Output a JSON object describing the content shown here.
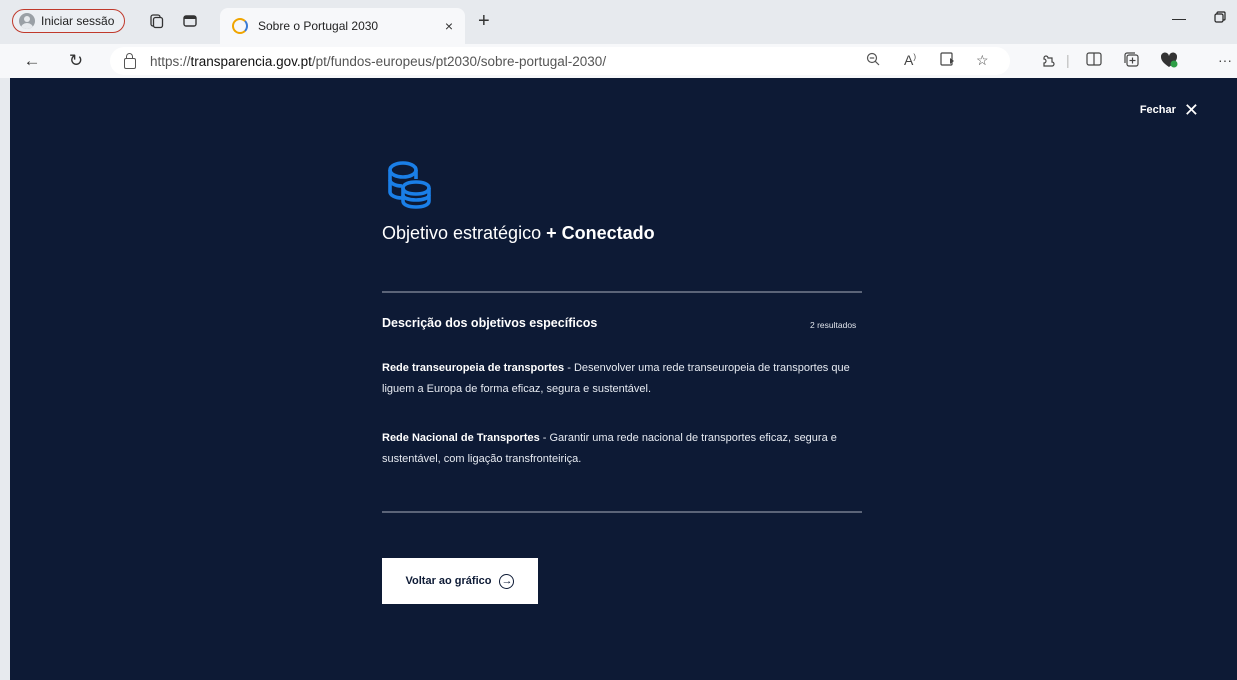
{
  "browser": {
    "profile_label": "Iniciar sessão",
    "tab_title": "Sobre o Portugal 2030",
    "tab_close": "×",
    "new_tab": "+",
    "url_prefix": "https://",
    "url_domain": "transparencia.gov.pt",
    "url_path": "/pt/fundos-europeus/pt2030/sobre-portugal-2030/"
  },
  "modal": {
    "close_label": "Fechar",
    "title_prefix": "Objetivo estratégico ",
    "title_bold": "+ Conectado",
    "section_title": "Descrição dos objetivos específicos",
    "results_count": "2 resultados",
    "items": [
      {
        "name": "Rede transeuropeia de transportes",
        "description": " - Desenvolver uma rede transeuropeia de transportes que liguem a Europa de forma eficaz, segura e sustentável."
      },
      {
        "name": "Rede Nacional de Transportes",
        "description": " - Garantir uma rede nacional de transportes eficaz, segura e sustentável, com ligação transfronteiriça."
      }
    ],
    "back_button": "Voltar ao gráfico"
  },
  "colors": {
    "page_bg": "#0d1a35",
    "accent": "#1a7fe8",
    "text": "#ffffff"
  }
}
